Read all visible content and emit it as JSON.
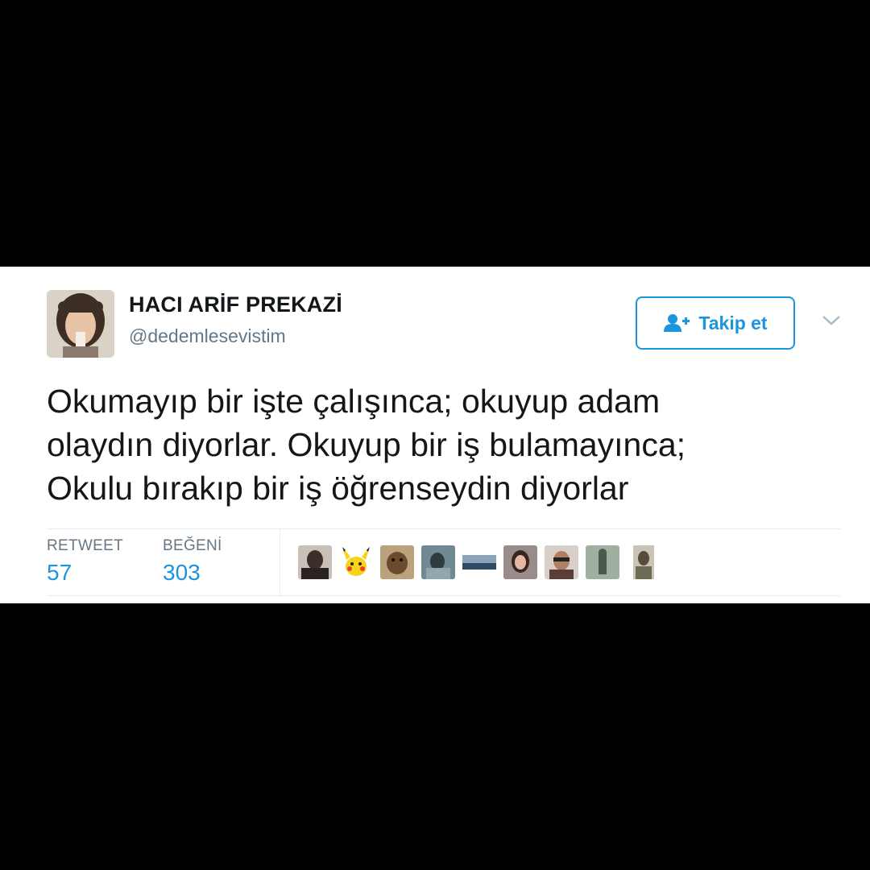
{
  "tweet": {
    "author": {
      "name": "HACI ARİF PREKAZİ",
      "handle": "@dedemlesevistim",
      "avatar_icon": "profile-photo"
    },
    "follow_button": {
      "label": "Takip et",
      "icon": "add-user-icon"
    },
    "menu_icon": "chevron-down-icon",
    "text_lines": [
      "Okumayıp bir işte çalışınca; okuyup adam",
      "olaydın diyorlar. Okuyup bir iş bulamayınca;",
      "Okulu bırakıp bir iş öğrenseydin diyorlar"
    ],
    "stats": {
      "retweet_label": "RETWEET",
      "retweet_count": "57",
      "like_label": "BEĞENİ",
      "like_count": "303"
    },
    "likers": [
      "liker-avatar-1",
      "liker-avatar-pikachu",
      "liker-avatar-3",
      "liker-avatar-4",
      "liker-avatar-5",
      "liker-avatar-6",
      "liker-avatar-7",
      "liker-avatar-8",
      "liker-avatar-9"
    ]
  },
  "colors": {
    "background": "#000000",
    "card": "#ffffff",
    "text": "#14171a",
    "secondary_text": "#657786",
    "accent": "#1b95e0",
    "divider": "#e6ecf0"
  }
}
